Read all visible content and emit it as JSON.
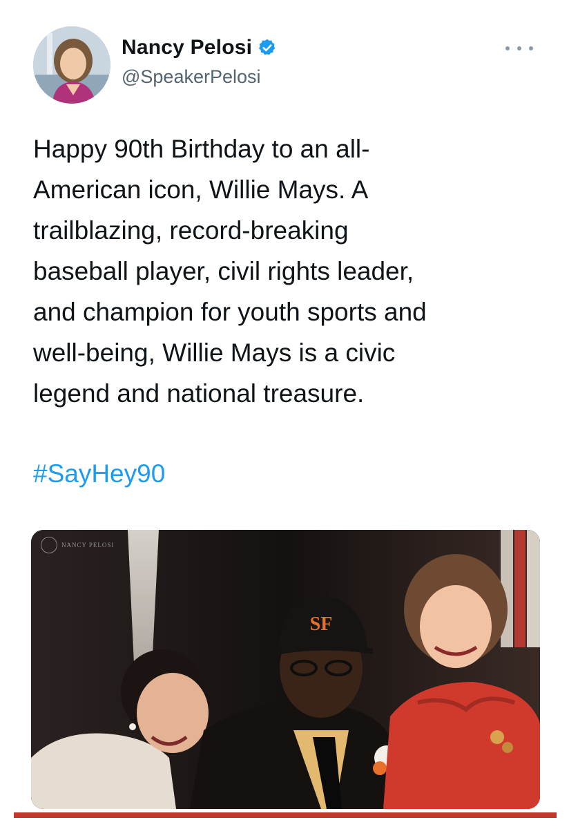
{
  "tweet": {
    "author": {
      "display_name": "Nancy Pelosi",
      "handle": "@SpeakerPelosi",
      "verified_icon": "verified-badge-icon",
      "avatar_icon": "profile-photo"
    },
    "more_icon": "ellipsis-icon",
    "text_lines": [
      "Happy 90th Birthday to an all-",
      "American icon, Willie Mays. A",
      "trailblazing, record-breaking",
      "baseball player, civil rights leader,",
      "and champion for youth sports and",
      "well-being, Willie Mays is a civic",
      "legend and national treasure."
    ],
    "hashtag": "#SayHey90",
    "media": {
      "watermark_text": "NANCY PELOSI",
      "cap_logo": "SF"
    }
  },
  "colors": {
    "text": "#0f1419",
    "secondary": "#536471",
    "link": "#1d9bf0",
    "verified": "#1d9bf0",
    "bottom_rule": "#c0392b"
  }
}
